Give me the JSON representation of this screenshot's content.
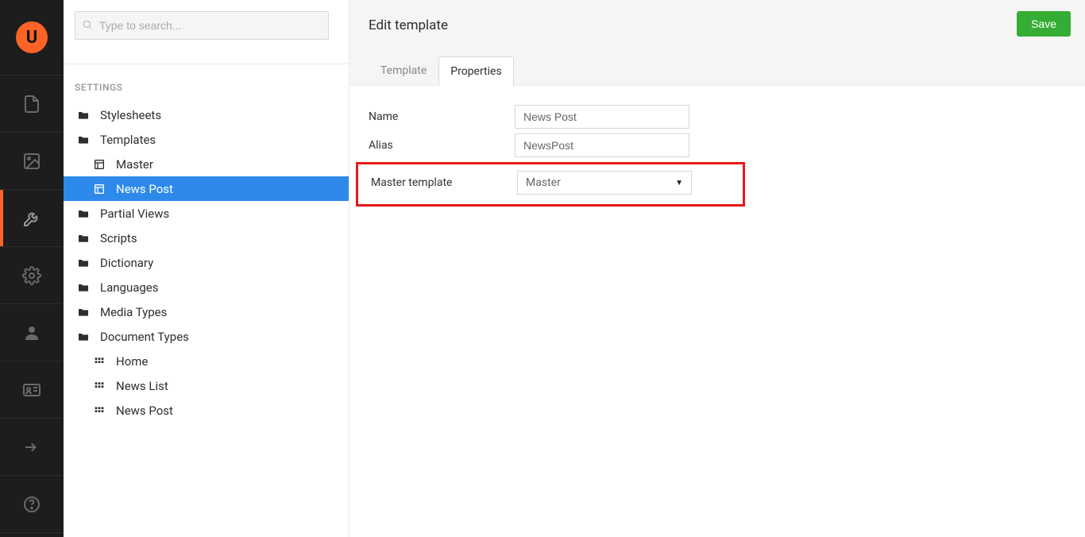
{
  "rail": {
    "logo_letter": "U",
    "items": [
      {
        "name": "content",
        "icon": "file"
      },
      {
        "name": "media",
        "icon": "image"
      },
      {
        "name": "settings",
        "icon": "wrench",
        "active": true
      },
      {
        "name": "developer",
        "icon": "gear"
      },
      {
        "name": "users",
        "icon": "user"
      },
      {
        "name": "members",
        "icon": "id-card"
      },
      {
        "name": "forms",
        "icon": "arrow-right"
      },
      {
        "name": "help",
        "icon": "help"
      }
    ]
  },
  "search": {
    "placeholder": "Type to search..."
  },
  "tree": {
    "section_label": "SETTINGS",
    "nodes": [
      {
        "label": "Stylesheets",
        "icon": "folder",
        "depth": 1
      },
      {
        "label": "Templates",
        "icon": "folder",
        "depth": 1
      },
      {
        "label": "Master",
        "icon": "template",
        "depth": 2
      },
      {
        "label": "News Post",
        "icon": "template",
        "depth": 3,
        "selected": true
      },
      {
        "label": "Partial Views",
        "icon": "folder",
        "depth": 1
      },
      {
        "label": "Scripts",
        "icon": "folder",
        "depth": 1
      },
      {
        "label": "Dictionary",
        "icon": "folder",
        "depth": 1
      },
      {
        "label": "Languages",
        "icon": "folder",
        "depth": 1
      },
      {
        "label": "Media Types",
        "icon": "folder",
        "depth": 1
      },
      {
        "label": "Document Types",
        "icon": "folder",
        "depth": 1
      },
      {
        "label": "Home",
        "icon": "doctype",
        "depth": 2
      },
      {
        "label": "News List",
        "icon": "doctype",
        "depth": 2
      },
      {
        "label": "News Post",
        "icon": "doctype",
        "depth": 2
      }
    ]
  },
  "editor": {
    "title": "Edit template",
    "save_label": "Save",
    "tabs": [
      {
        "label": "Template",
        "active": false
      },
      {
        "label": "Properties",
        "active": true
      }
    ],
    "fields": {
      "name_label": "Name",
      "name_value": "News Post",
      "alias_label": "Alias",
      "alias_value": "NewsPost",
      "master_label": "Master template",
      "master_value": "Master"
    }
  }
}
